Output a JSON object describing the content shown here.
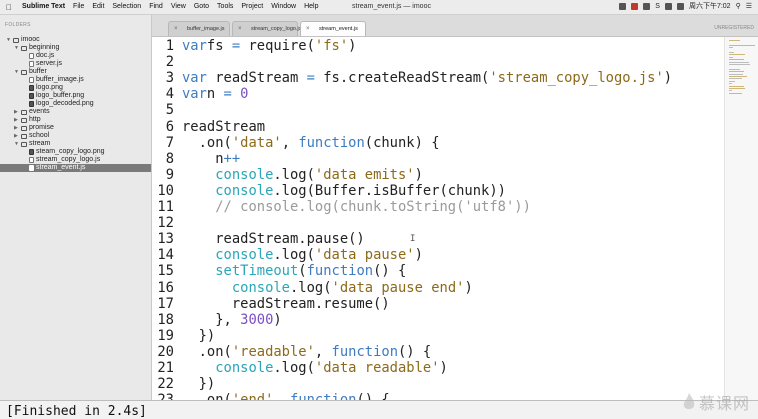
{
  "menubar": {
    "app_name": "Sublime Text",
    "items": [
      "File",
      "Edit",
      "Selection",
      "Find",
      "View",
      "Goto",
      "Tools",
      "Project",
      "Window",
      "Help"
    ],
    "window_title": "stream_event.js — imooc",
    "status_text": "S",
    "clock": "周六下午7:02"
  },
  "sidebar": {
    "title": "FOLDERS",
    "tree": [
      {
        "label": "imooc",
        "type": "folder",
        "open": true,
        "depth": 0
      },
      {
        "label": "beginning",
        "type": "folder",
        "open": true,
        "depth": 1
      },
      {
        "label": "doc.js",
        "type": "file",
        "depth": 2
      },
      {
        "label": "server.js",
        "type": "file",
        "depth": 2
      },
      {
        "label": "buffer",
        "type": "folder",
        "open": true,
        "depth": 1
      },
      {
        "label": "buffer_image.js",
        "type": "file",
        "depth": 2
      },
      {
        "label": "logo.png",
        "type": "image",
        "depth": 2
      },
      {
        "label": "logo_buffer.png",
        "type": "image",
        "depth": 2
      },
      {
        "label": "logo_decoded.png",
        "type": "image",
        "depth": 2
      },
      {
        "label": "events",
        "type": "folder",
        "open": false,
        "depth": 1
      },
      {
        "label": "http",
        "type": "folder",
        "open": false,
        "depth": 1
      },
      {
        "label": "promise",
        "type": "folder",
        "open": false,
        "depth": 1
      },
      {
        "label": "school",
        "type": "folder",
        "open": false,
        "depth": 1
      },
      {
        "label": "stream",
        "type": "folder",
        "open": true,
        "depth": 1
      },
      {
        "label": "steam_copy_logo.png",
        "type": "image",
        "depth": 2
      },
      {
        "label": "stream_copy_logo.js",
        "type": "file",
        "depth": 2
      },
      {
        "label": "stream_event.js",
        "type": "file",
        "depth": 2,
        "selected": true
      }
    ]
  },
  "tabs": [
    {
      "label": "buffer_image.js",
      "active": false
    },
    {
      "label": "stream_copy_logo.js",
      "active": false
    },
    {
      "label": "stream_event.js",
      "active": true
    }
  ],
  "unregistered_label": "UNREGISTERED",
  "editor": {
    "lines": [
      {
        "n": "1",
        "tokens": [
          [
            "kw",
            "var"
          ],
          [
            "",
            "fs "
          ],
          [
            "kw",
            "="
          ],
          [
            "",
            " require("
          ],
          [
            "str",
            "'fs'"
          ],
          [
            "",
            ")"
          ]
        ]
      },
      {
        "n": "2",
        "tokens": []
      },
      {
        "n": "3",
        "tokens": [
          [
            "kw",
            "var"
          ],
          [
            "",
            "",
            " "
          ],
          [
            "",
            "readStream "
          ],
          [
            "kw",
            "="
          ],
          [
            "",
            " fs.createReadStream("
          ],
          [
            "str",
            "'stream_copy_logo.js'"
          ],
          [
            "",
            ")"
          ]
        ]
      },
      {
        "n": "4",
        "tokens": [
          [
            "kw",
            "var"
          ],
          [
            "",
            "n "
          ],
          [
            "kw",
            "="
          ],
          [
            "num",
            " 0"
          ]
        ]
      },
      {
        "n": "5",
        "tokens": []
      },
      {
        "n": "6",
        "tokens": [
          [
            "",
            "readStream"
          ]
        ]
      },
      {
        "n": "7",
        "tokens": [
          [
            "",
            "  .on("
          ],
          [
            "str",
            "'data'"
          ],
          [
            "",
            ", "
          ],
          [
            "kw",
            "function"
          ],
          [
            "",
            "(chunk) {"
          ]
        ]
      },
      {
        "n": "8",
        "tokens": [
          [
            "",
            "    n"
          ],
          [
            "kw",
            "++"
          ]
        ]
      },
      {
        "n": "9",
        "tokens": [
          [
            "fn",
            "    console"
          ],
          [
            "",
            ".log("
          ],
          [
            "str",
            "'data emits'"
          ],
          [
            "",
            ")"
          ]
        ]
      },
      {
        "n": "10",
        "tokens": [
          [
            "fn",
            "    console"
          ],
          [
            "",
            ".log(Buffer.isBuffer(chunk))"
          ]
        ]
      },
      {
        "n": "11",
        "tokens": [
          [
            "cmt",
            "    // console.log(chunk.toString('utf8'))"
          ]
        ]
      },
      {
        "n": "12",
        "tokens": []
      },
      {
        "n": "13",
        "tokens": [
          [
            "",
            "    readStream.pause()"
          ]
        ]
      },
      {
        "n": "14",
        "tokens": [
          [
            "fn",
            "    console"
          ],
          [
            "",
            ".log("
          ],
          [
            "str",
            "'data pause'"
          ],
          [
            "",
            ")"
          ]
        ]
      },
      {
        "n": "15",
        "tokens": [
          [
            "fn",
            "    setTimeout"
          ],
          [
            "",
            "("
          ],
          [
            "kw",
            "function"
          ],
          [
            "",
            "() {"
          ]
        ]
      },
      {
        "n": "16",
        "tokens": [
          [
            "fn",
            "      console"
          ],
          [
            "",
            ".log("
          ],
          [
            "str",
            "'data pause end'"
          ],
          [
            "",
            ")"
          ]
        ]
      },
      {
        "n": "17",
        "tokens": [
          [
            "",
            "      readStream.resume()"
          ]
        ]
      },
      {
        "n": "18",
        "tokens": [
          [
            "",
            "    }, "
          ],
          [
            "num",
            "3000"
          ],
          [
            "",
            ")"
          ]
        ]
      },
      {
        "n": "19",
        "tokens": [
          [
            "",
            "  })"
          ]
        ]
      },
      {
        "n": "20",
        "tokens": [
          [
            "",
            "  .on("
          ],
          [
            "str",
            "'readable'"
          ],
          [
            "",
            ", "
          ],
          [
            "kw",
            "function"
          ],
          [
            "",
            "() {"
          ]
        ]
      },
      {
        "n": "21",
        "tokens": [
          [
            "fn",
            "    console"
          ],
          [
            "",
            ".log("
          ],
          [
            "str",
            "'data readable'"
          ],
          [
            "",
            ")"
          ]
        ]
      },
      {
        "n": "22",
        "tokens": [
          [
            "",
            "  })"
          ]
        ]
      },
      {
        "n": "23",
        "tokens": [
          [
            "",
            "  .on("
          ],
          [
            "str",
            "'end'"
          ],
          [
            "",
            ", "
          ],
          [
            "kw",
            "function"
          ],
          [
            "",
            "() {"
          ]
        ]
      }
    ]
  },
  "output": {
    "text": "[Finished in 2.4s]"
  },
  "watermark": {
    "text": "慕课网"
  },
  "colors": {
    "keyword": "#3e7cc1",
    "string": "#8c6a1a",
    "number": "#7a4fc2",
    "comment": "#9a9a9a",
    "function": "#2aa6b8"
  }
}
